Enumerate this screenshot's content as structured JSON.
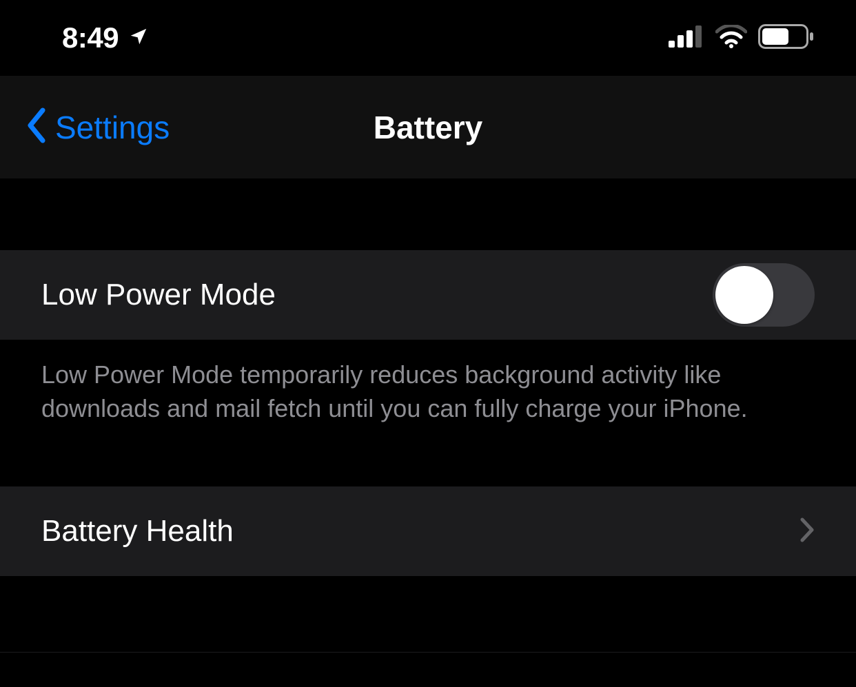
{
  "status": {
    "time": "8:49",
    "location_icon": "location-arrow",
    "cellular_bars": 3,
    "cellular_total": 4,
    "wifi_strength": 2,
    "battery_percent": 60
  },
  "nav": {
    "back_label": "Settings",
    "title": "Battery"
  },
  "rows": {
    "low_power_mode": {
      "label": "Low Power Mode",
      "on": false,
      "footer": "Low Power Mode temporarily reduces background activity like downloads and mail fetch until you can fully charge your iPhone."
    },
    "battery_health": {
      "label": "Battery Health"
    }
  }
}
